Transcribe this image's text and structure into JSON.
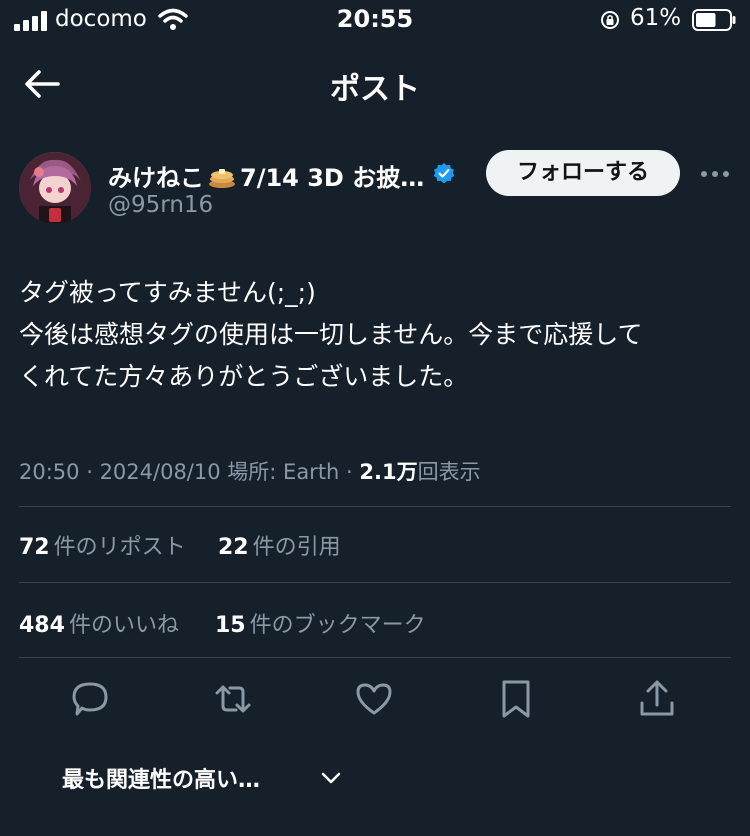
{
  "status_bar": {
    "carrier": "docomo",
    "time": "20:55",
    "battery_percent": "61%",
    "battery_level": 0.61
  },
  "header": {
    "back_icon": "arrow-left-icon",
    "title": "ポスト"
  },
  "author": {
    "name_prefix": "みけねこ",
    "name_suffix": "7/14 3D お披…",
    "handle": "@95rn16",
    "verified": true,
    "follow_label": "フォローする"
  },
  "post": {
    "lines": [
      "タグ被ってすみません(;_;)",
      "今後は感想タグの使用は一切しません。今まで応援して",
      "くれてた方々ありがとうございました。"
    ]
  },
  "meta": {
    "time": "20:50",
    "date": "2024/08/10",
    "location": "場所: Earth",
    "views_value": "2.1万",
    "views_label": "回表示"
  },
  "stats": {
    "reposts_value": "72",
    "reposts_label": "件のリポスト",
    "quotes_value": "22",
    "quotes_label": "件の引用",
    "likes_value": "484",
    "likes_label": "件のいいね",
    "bookmarks_value": "15",
    "bookmarks_label": "件のブックマーク"
  },
  "actions": [
    "reply-icon",
    "repost-icon",
    "like-icon",
    "bookmark-icon",
    "share-icon"
  ],
  "sort": {
    "label": "最も関連性の高い…"
  },
  "colors": {
    "background": "#15202b",
    "secondary_text": "#8b98a5",
    "divider": "#38444d",
    "verified": "#1d9bf0",
    "follow_bg": "#eff3f4"
  }
}
